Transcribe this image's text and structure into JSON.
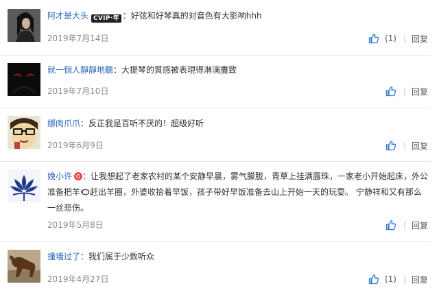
{
  "comments": [
    {
      "username": "阿才是大头",
      "badge": "CVIP·年",
      "text": "好弦和好琴真的对音色有大影响hhh",
      "date": "2019年7月14日",
      "likes": "(1)",
      "reply": "回复"
    },
    {
      "username": "就一個人靜靜地聽",
      "text": "大提琴的質感被表現得淋漓盡致",
      "date": "2019年7月10日",
      "likes": "",
      "reply": "回复"
    },
    {
      "username": "娜肉爪爪",
      "text": "反正我是百听不厌的！超级好听",
      "date": "2019年6月9日",
      "likes": "",
      "reply": "回复"
    },
    {
      "username": "娩小许",
      "text_part1": "让我想起了老家农村的某个安静早晨，雾气朦胧，青草上挂满露珠，一家老小开始起床，外公准备把羊",
      "text_part2": "赶出羊圈，外婆收拾着早饭，孩子带好早饭准备去山上开始一天的玩耍。 宁静祥和又有那么一丝悲伤。",
      "date": "2019年5月8日",
      "likes": "",
      "reply": "回复"
    },
    {
      "username": "撞墙过了",
      "text": "我们属于少数听众",
      "date": "2019年4月27日",
      "likes": "(1)",
      "reply": "回复"
    }
  ],
  "colon": "：",
  "colors": {
    "link": "#2c67b5",
    "like_icon": "#2b78d4",
    "divider": "#e4e4e4"
  },
  "icons": {
    "like": "thumbs-up-icon",
    "sheep": "sheep-emoji-icon",
    "vip": "vip-badge-icon"
  }
}
